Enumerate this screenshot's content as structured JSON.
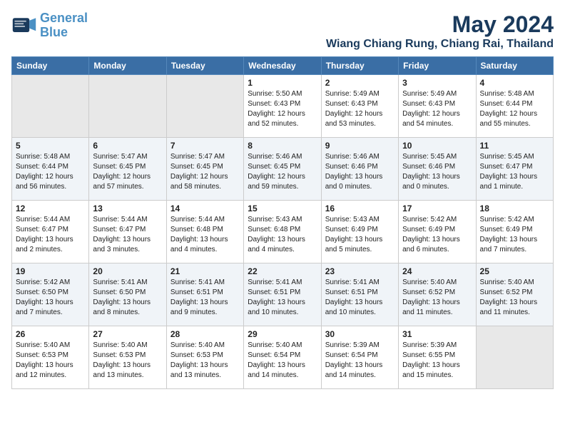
{
  "logo": {
    "line1": "General",
    "line2": "Blue"
  },
  "title": "May 2024",
  "location": "Wiang Chiang Rung, Chiang Rai, Thailand",
  "days_of_week": [
    "Sunday",
    "Monday",
    "Tuesday",
    "Wednesday",
    "Thursday",
    "Friday",
    "Saturday"
  ],
  "weeks": [
    [
      {
        "day": "",
        "info": ""
      },
      {
        "day": "",
        "info": ""
      },
      {
        "day": "",
        "info": ""
      },
      {
        "day": "1",
        "info": "Sunrise: 5:50 AM\nSunset: 6:43 PM\nDaylight: 12 hours\nand 52 minutes."
      },
      {
        "day": "2",
        "info": "Sunrise: 5:49 AM\nSunset: 6:43 PM\nDaylight: 12 hours\nand 53 minutes."
      },
      {
        "day": "3",
        "info": "Sunrise: 5:49 AM\nSunset: 6:43 PM\nDaylight: 12 hours\nand 54 minutes."
      },
      {
        "day": "4",
        "info": "Sunrise: 5:48 AM\nSunset: 6:44 PM\nDaylight: 12 hours\nand 55 minutes."
      }
    ],
    [
      {
        "day": "5",
        "info": "Sunrise: 5:48 AM\nSunset: 6:44 PM\nDaylight: 12 hours\nand 56 minutes."
      },
      {
        "day": "6",
        "info": "Sunrise: 5:47 AM\nSunset: 6:45 PM\nDaylight: 12 hours\nand 57 minutes."
      },
      {
        "day": "7",
        "info": "Sunrise: 5:47 AM\nSunset: 6:45 PM\nDaylight: 12 hours\nand 58 minutes."
      },
      {
        "day": "8",
        "info": "Sunrise: 5:46 AM\nSunset: 6:45 PM\nDaylight: 12 hours\nand 59 minutes."
      },
      {
        "day": "9",
        "info": "Sunrise: 5:46 AM\nSunset: 6:46 PM\nDaylight: 13 hours\nand 0 minutes."
      },
      {
        "day": "10",
        "info": "Sunrise: 5:45 AM\nSunset: 6:46 PM\nDaylight: 13 hours\nand 0 minutes."
      },
      {
        "day": "11",
        "info": "Sunrise: 5:45 AM\nSunset: 6:47 PM\nDaylight: 13 hours\nand 1 minute."
      }
    ],
    [
      {
        "day": "12",
        "info": "Sunrise: 5:44 AM\nSunset: 6:47 PM\nDaylight: 13 hours\nand 2 minutes."
      },
      {
        "day": "13",
        "info": "Sunrise: 5:44 AM\nSunset: 6:47 PM\nDaylight: 13 hours\nand 3 minutes."
      },
      {
        "day": "14",
        "info": "Sunrise: 5:44 AM\nSunset: 6:48 PM\nDaylight: 13 hours\nand 4 minutes."
      },
      {
        "day": "15",
        "info": "Sunrise: 5:43 AM\nSunset: 6:48 PM\nDaylight: 13 hours\nand 4 minutes."
      },
      {
        "day": "16",
        "info": "Sunrise: 5:43 AM\nSunset: 6:49 PM\nDaylight: 13 hours\nand 5 minutes."
      },
      {
        "day": "17",
        "info": "Sunrise: 5:42 AM\nSunset: 6:49 PM\nDaylight: 13 hours\nand 6 minutes."
      },
      {
        "day": "18",
        "info": "Sunrise: 5:42 AM\nSunset: 6:49 PM\nDaylight: 13 hours\nand 7 minutes."
      }
    ],
    [
      {
        "day": "19",
        "info": "Sunrise: 5:42 AM\nSunset: 6:50 PM\nDaylight: 13 hours\nand 7 minutes."
      },
      {
        "day": "20",
        "info": "Sunrise: 5:41 AM\nSunset: 6:50 PM\nDaylight: 13 hours\nand 8 minutes."
      },
      {
        "day": "21",
        "info": "Sunrise: 5:41 AM\nSunset: 6:51 PM\nDaylight: 13 hours\nand 9 minutes."
      },
      {
        "day": "22",
        "info": "Sunrise: 5:41 AM\nSunset: 6:51 PM\nDaylight: 13 hours\nand 10 minutes."
      },
      {
        "day": "23",
        "info": "Sunrise: 5:41 AM\nSunset: 6:51 PM\nDaylight: 13 hours\nand 10 minutes."
      },
      {
        "day": "24",
        "info": "Sunrise: 5:40 AM\nSunset: 6:52 PM\nDaylight: 13 hours\nand 11 minutes."
      },
      {
        "day": "25",
        "info": "Sunrise: 5:40 AM\nSunset: 6:52 PM\nDaylight: 13 hours\nand 11 minutes."
      }
    ],
    [
      {
        "day": "26",
        "info": "Sunrise: 5:40 AM\nSunset: 6:53 PM\nDaylight: 13 hours\nand 12 minutes."
      },
      {
        "day": "27",
        "info": "Sunrise: 5:40 AM\nSunset: 6:53 PM\nDaylight: 13 hours\nand 13 minutes."
      },
      {
        "day": "28",
        "info": "Sunrise: 5:40 AM\nSunset: 6:53 PM\nDaylight: 13 hours\nand 13 minutes."
      },
      {
        "day": "29",
        "info": "Sunrise: 5:40 AM\nSunset: 6:54 PM\nDaylight: 13 hours\nand 14 minutes."
      },
      {
        "day": "30",
        "info": "Sunrise: 5:39 AM\nSunset: 6:54 PM\nDaylight: 13 hours\nand 14 minutes."
      },
      {
        "day": "31",
        "info": "Sunrise: 5:39 AM\nSunset: 6:55 PM\nDaylight: 13 hours\nand 15 minutes."
      },
      {
        "day": "",
        "info": ""
      }
    ]
  ]
}
